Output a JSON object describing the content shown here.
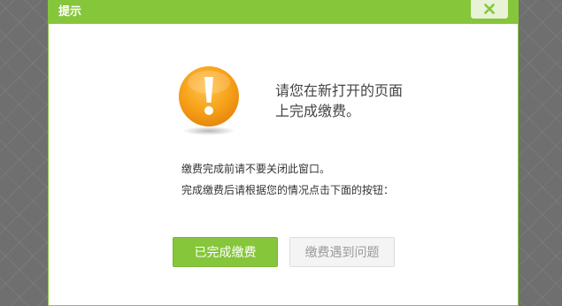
{
  "dialog": {
    "title": "提示",
    "close_icon": "close-icon",
    "warning_icon": "exclamation-warning-icon",
    "message_line1": "请您在新打开的页面",
    "message_line2": "上完成缴费。",
    "note_line1": "缴费完成前请不要关闭此窗口。",
    "note_line2": "完成缴费后请根据您的情况点击下面的按钮：",
    "primary_button": "已完成缴费",
    "secondary_button": "缴费遇到问题"
  },
  "colors": {
    "accent": "#86c63a",
    "warning": "#f7a21a",
    "overlay": "#6f6f6f"
  }
}
